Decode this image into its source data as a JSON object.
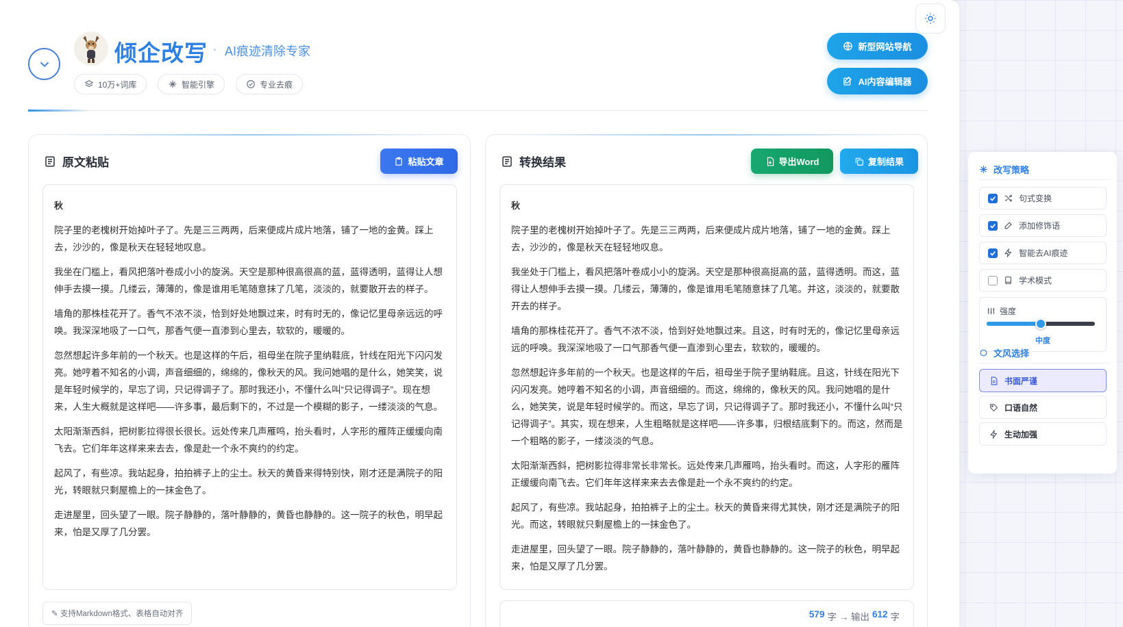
{
  "header": {
    "brand_title": "倾企改写",
    "brand_separator": "·",
    "brand_subtitle": "AI痕迹清除专家",
    "tags": [
      "10万+词库",
      "智能引擎",
      "专业去痕"
    ],
    "nav_buttons": [
      "新型网站导航",
      "AI内容编辑器"
    ]
  },
  "source_panel": {
    "title": "原文粘贴",
    "paste_button": "粘贴文章",
    "doc_title": "秋",
    "paragraphs": [
      "院子里的老槐树开始掉叶子了。先是三三两两，后来便成片成片地落，铺了一地的金黄。踩上去，沙沙的，像是秋天在轻轻地叹息。",
      "我坐在门槛上，看风把落叶卷成小小的旋涡。天空是那种很高很高的蓝，蓝得透明，蓝得让人想伸手去摸一摸。几缕云，薄薄的，像是谁用毛笔随意抹了几笔，淡淡的，就要散开去的样子。",
      "墙角的那株桂花开了。香气不浓不淡，恰到好处地飘过来，时有时无的，像记忆里母亲远远的呼唤。我深深地吸了一口气，那香气便一直渗到心里去，软软的，暖暖的。",
      "忽然想起许多年前的一个秋天。也是这样的午后，祖母坐在院子里纳鞋底，针线在阳光下闪闪发亮。她哼着不知名的小调，声音细细的，绵绵的，像秋天的风。我问她唱的是什么，她笑笑，说是年轻时候学的，早忘了词，只记得调子了。那时我还小，不懂什么叫“只记得调子”。现在想来，人生大概就是这样吧——许多事，最后剩下的，不过是一个模糊的影子，一缕淡淡的气息。",
      "太阳渐渐西斜，把树影拉得很长很长。远处传来几声雁鸣，抬头看时，人字形的雁阵正缓缓向南飞去。它们年年这样来来去去，像是赴一个永不爽约的约定。",
      "起风了，有些凉。我站起身，拍拍裤子上的尘土。秋天的黄昏来得特别快，刚才还是满院子的阳光，转眼就只剩屋檐上的一抹金色了。",
      "走进屋里，回头望了一眼。院子静静的，落叶静静的，黄昏也静静的。这一院子的秋色，明早起来，怕是又厚了几分罢。"
    ],
    "hint": "✎ 支持Markdown格式、表格自动对齐"
  },
  "result_panel": {
    "title": "转换结果",
    "export_button": "导出Word",
    "copy_button": "复制结果",
    "doc_title": "秋",
    "paragraphs": [
      "院子里的老槐树开始掉叶子了。先是三三两两，后来便成片成片地落，铺了一地的金黄。踩上去，沙沙的，像是秋天在轻轻地叹息。",
      "我坐处于门槛上，看风把落叶卷成小小的旋涡。天空是那种很高挺高的蓝，蓝得透明。而这，蓝得让人想伸手去摸一摸。几缕云，薄薄的，像是谁用毛笔随意抹了几笔。并这，淡淡的，就要散开去的样子。",
      "墙角的那株桂花开了。香气不浓不淡，恰到好处地飘过来。且这，时有时无的，像记忆里母亲远远的呼唤。我深深地吸了一口气那香气便一直渗到心里去，软软的，暖暖的。",
      "忽然想起许多年前的一个秋天。也是这样的午后，祖母坐于院子里纳鞋底。且这，针线在阳光下闪闪发亮。她哼着不知名的小调，声音细细的。而这，绵绵的，像秋天的风。我问她唱的是什么，她笑笑，说是年轻时候学的。而这，早忘了词，只记得调子了。那时我还小，不懂什么叫“只记得调子”。其实，现在想来，人生粗略就是这样吧——许多事，归根结底剩下的。而这，然而是一个粗略的影子，一缕淡淡的气息。",
      "太阳渐渐西斜，把树影拉得非常长非常长。远处传来几声雁鸣，抬头看时。而这，人字形的雁阵正缓缓向南飞去。它们年年这样来来去去像是赴一个永不爽约的约定。",
      "起风了，有些凉。我站起身，拍拍裤子上的尘土。秋天的黄昏来得尤其快，刚才还是满院子的阳光。而这，转眼就只剩屋檐上的一抹金色了。",
      "走进屋里，回头望了一眼。院子静静的，落叶静静的，黄昏也静静的。这一院子的秋色，明早起来，怕是又厚了几分罢。"
    ],
    "count_input": "579",
    "count_unit_1": "字 → 输出",
    "count_output": "612",
    "count_unit_2": "字"
  },
  "strategy_panel": {
    "title": "改写策略",
    "options": [
      {
        "label": "句式变换",
        "checked": true
      },
      {
        "label": "添加修饰语",
        "checked": true
      },
      {
        "label": "智能去AI痕迹",
        "checked": true
      },
      {
        "label": "学术模式",
        "checked": false
      }
    ],
    "strength_label": "强度",
    "strength_value_label": "中度",
    "strength_level": 0.5,
    "style_title": "文风选择",
    "styles": [
      {
        "label": "书面严谨",
        "active": true
      },
      {
        "label": "口语自然",
        "active": false
      },
      {
        "label": "生动加强",
        "active": false
      }
    ]
  },
  "colors": {
    "accent": "#2f80e0",
    "primary_button": "#2f6ae6",
    "export_green": "#12985f",
    "copy_cyan": "#1a94e2"
  }
}
